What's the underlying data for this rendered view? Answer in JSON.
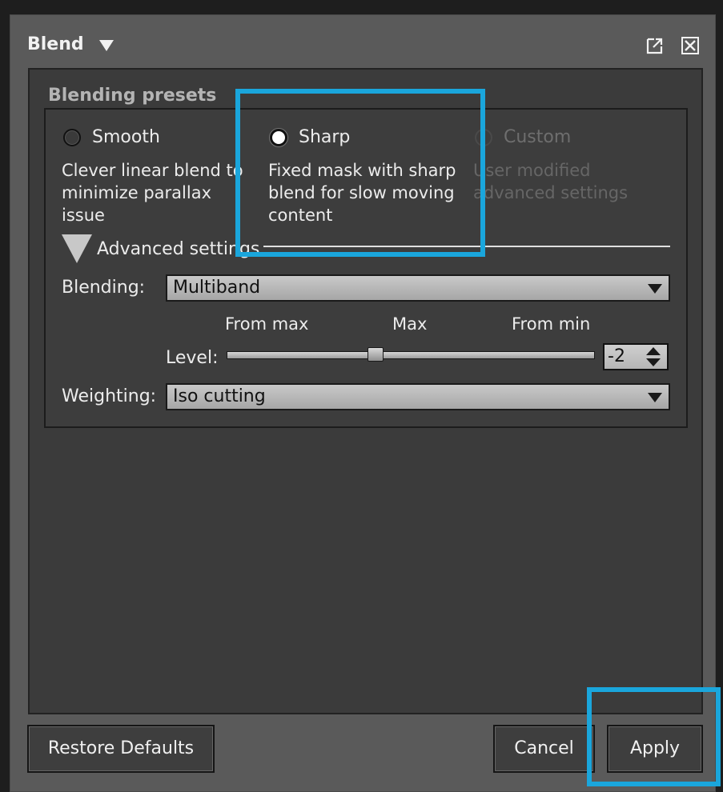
{
  "window": {
    "title": "Blend"
  },
  "titlebar_icons": [
    "popout-icon",
    "close-icon"
  ],
  "presets": {
    "label": "Blending presets",
    "options": [
      {
        "label": "Smooth",
        "description": "Clever linear blend to\nminimize parallax issue",
        "state": "unselected"
      },
      {
        "label": "Sharp",
        "description": "Fixed mask with sharp\nblend for slow moving\ncontent",
        "state": "selected"
      },
      {
        "label": "Custom",
        "description": "User modified\nadvanced settings",
        "state": "disabled"
      }
    ]
  },
  "advanced": {
    "label": "Advanced settings",
    "blending": {
      "label": "Blending:",
      "value": "Multiband"
    },
    "level": {
      "label": "Level:",
      "ticks": [
        "From max",
        "Max",
        "From min"
      ],
      "value": "-2"
    },
    "weighting": {
      "label": "Weighting:",
      "value": "Iso cutting"
    }
  },
  "buttons": {
    "restore": "Restore Defaults",
    "cancel": "Cancel",
    "apply": "Apply"
  },
  "colors": {
    "highlight": "#1aa6dc",
    "panel_bg": "#5a5a5a",
    "inner_bg": "#3b3b3b"
  }
}
